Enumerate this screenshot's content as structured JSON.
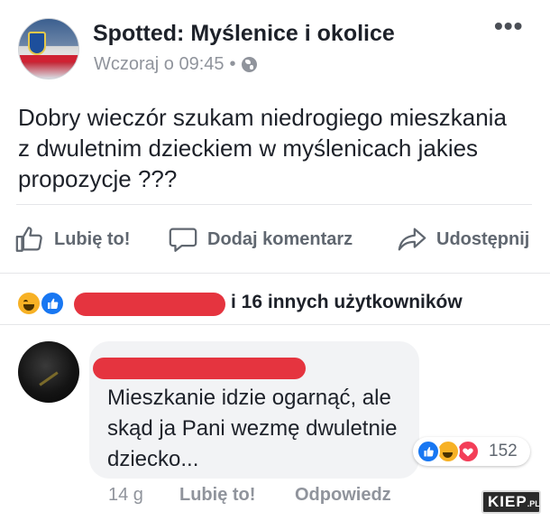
{
  "post": {
    "page_name": "Spotted: Myślenice i okolice",
    "timestamp": "Wczoraj o 09:45",
    "separator": "•",
    "privacy_icon": "globe-icon",
    "more_icon_glyph": "•••",
    "text": "Dobry wieczór szukam niedrogiego mieszkania z dwuletnim dzieckiem w myślenicach jakies propozycje ???"
  },
  "actions": {
    "like_label": "Lubię to!",
    "comment_label": "Dodaj komentarz",
    "share_label": "Udostępnij"
  },
  "reactions": {
    "icons": [
      "haha-icon",
      "like-icon"
    ],
    "others_text": "i 16 innych użytkowników"
  },
  "comment": {
    "text": "Mieszkanie idzie ogarnąć, ale skąd ja Pani wezmę dwuletnie dziecko...",
    "reaction_icons": [
      "like-icon",
      "haha-icon",
      "love-icon"
    ],
    "reaction_count": "152",
    "time": "14 g",
    "like_label": "Lubię to!",
    "reply_label": "Odpowiedz"
  },
  "watermark": {
    "text": "KIEP",
    "suffix": ".PL"
  },
  "colors": {
    "text_primary": "#1d2129",
    "text_secondary": "#90949c",
    "action_gray": "#606770",
    "redaction_red": "#e5343f",
    "like_blue": "#1877f2",
    "haha_yellow": "#f7b125",
    "love_red": "#f33e58",
    "bubble_bg": "#f2f3f5"
  }
}
